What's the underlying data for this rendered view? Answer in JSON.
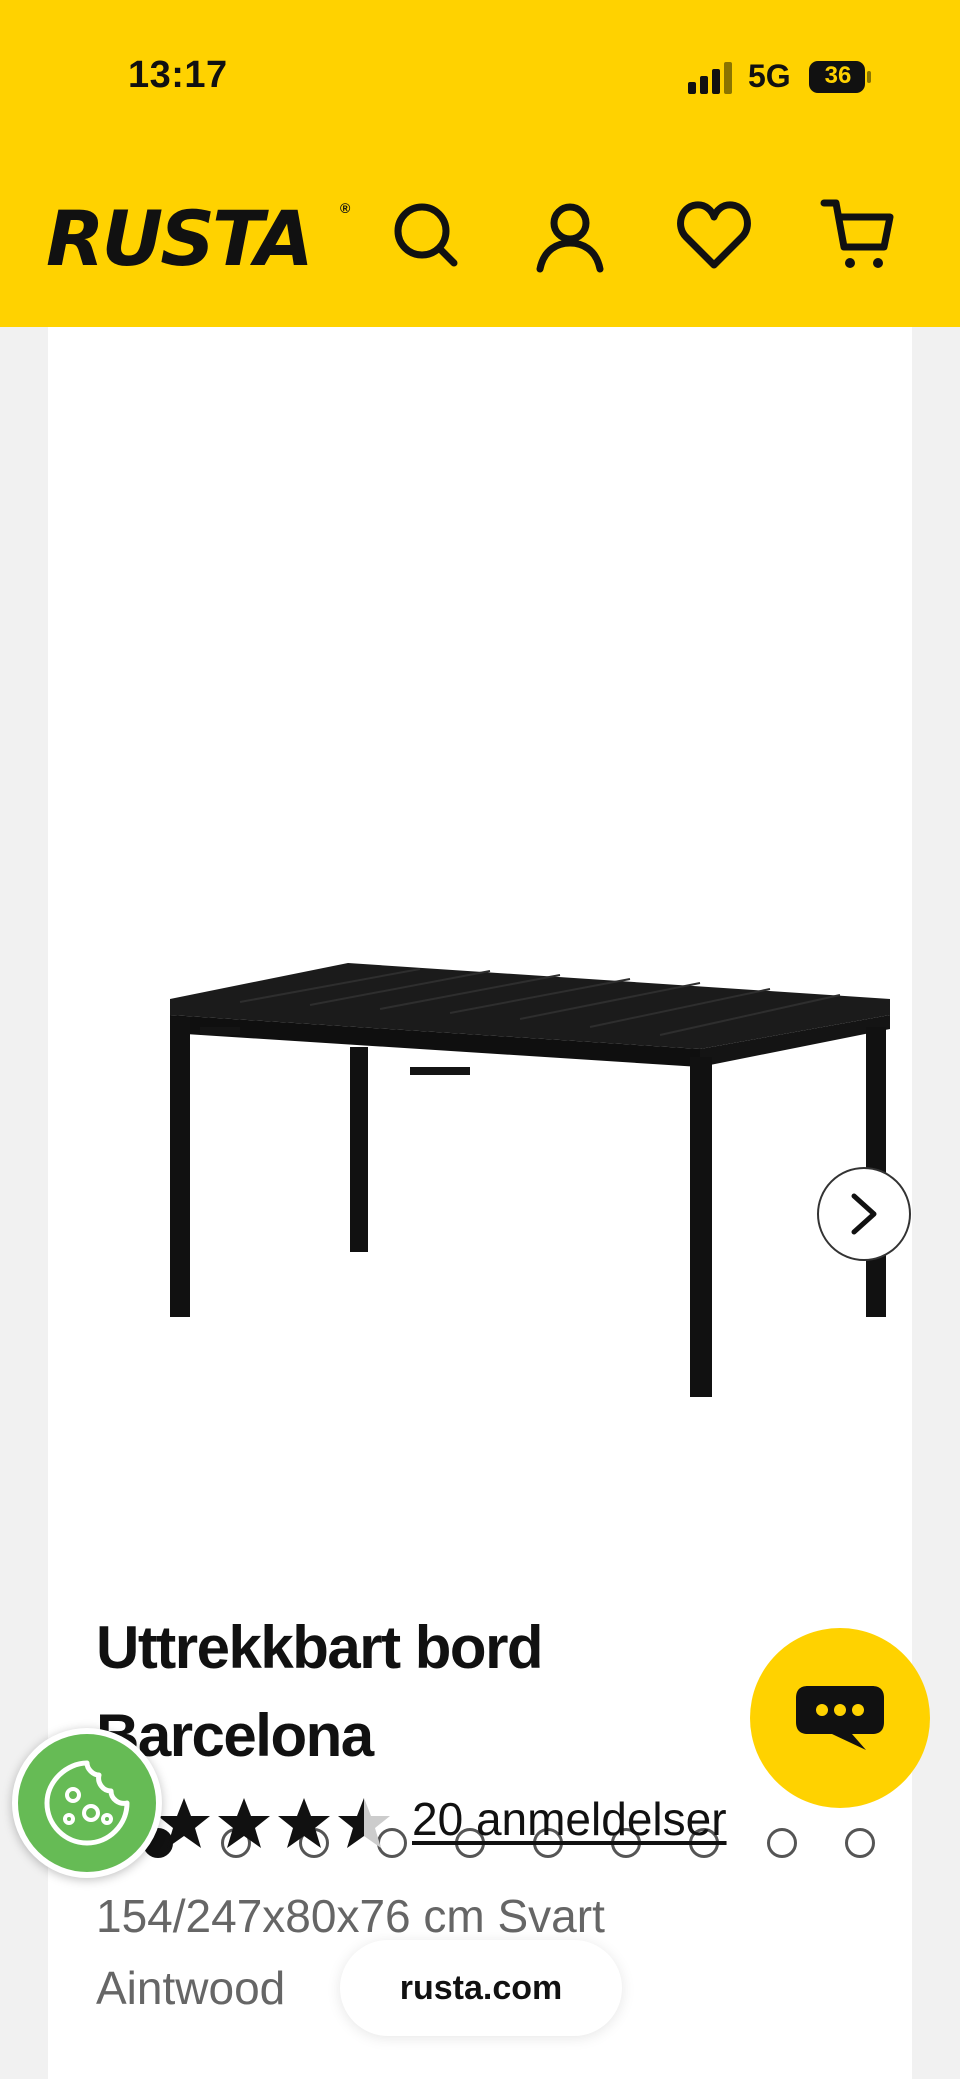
{
  "status_bar": {
    "time": "13:17",
    "network": "5G",
    "battery": "36"
  },
  "header": {
    "logo": "RUSTA",
    "logo_mark": "®",
    "icons": [
      "search-icon",
      "account-icon",
      "wishlist-heart-icon",
      "cart-icon"
    ]
  },
  "gallery": {
    "image_count": 10,
    "active_index": 0
  },
  "product": {
    "title": "Uttrekkbart bord Barcelona",
    "rating": 4.5,
    "reviews_label": "20 anmeldelser",
    "subtitle": "154/247x80x76 cm Svart Aintwood"
  },
  "browser": {
    "url": "rusta.com"
  },
  "colors": {
    "brand_yellow": "#ffd200",
    "cookie_green": "#66bb55"
  }
}
